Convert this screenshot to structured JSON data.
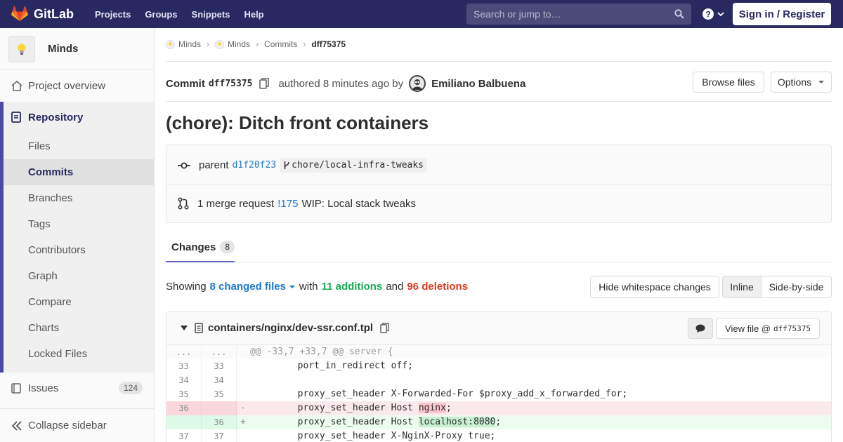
{
  "navbar": {
    "brand": "GitLab",
    "links": [
      "Projects",
      "Groups",
      "Snippets",
      "Help"
    ],
    "search_placeholder": "Search or jump to…",
    "signin_label": "Sign in / Register"
  },
  "sidebar": {
    "project_name": "Minds",
    "project_overview": "Project overview",
    "repository": "Repository",
    "repo_items": [
      "Files",
      "Commits",
      "Branches",
      "Tags",
      "Contributors",
      "Graph",
      "Compare",
      "Charts",
      "Locked Files"
    ],
    "issues": "Issues",
    "issues_count": "124",
    "collapse": "Collapse sidebar"
  },
  "breadcrumb": [
    "Minds",
    "Minds",
    "Commits",
    "dff75375"
  ],
  "commit": {
    "label": "Commit",
    "sha": "dff75375",
    "authored": "authored 8 minutes ago by",
    "author": "Emiliano Balbuena",
    "browse_files": "Browse files",
    "options": "Options",
    "title": "(chore): Ditch front containers",
    "parent_label": "parent",
    "parent_sha": "d1f20f23",
    "branch": "chore/local-infra-tweaks",
    "mr_text": "1 merge request",
    "mr_id": "!175",
    "mr_title": "WIP: Local stack tweaks"
  },
  "changes": {
    "tab_label": "Changes",
    "count": "8",
    "showing": "Showing",
    "files_changed": "8 changed files",
    "with": "with",
    "additions": "11 additions",
    "and": "and",
    "deletions": "96 deletions",
    "hide_whitespace": "Hide whitespace changes",
    "inline": "Inline",
    "side_by_side": "Side-by-side"
  },
  "file": {
    "path": "containers/nginx/dev-ssr.conf.tpl",
    "view_file_label": "View file @",
    "view_file_sha": "dff75375",
    "lines": [
      {
        "old": "...",
        "new": "...",
        "type": "hunk",
        "sign": "",
        "text": "@@ -33,7 +33,7 @@ server {"
      },
      {
        "old": "33",
        "new": "33",
        "type": "ctx",
        "sign": "",
        "text": "        port_in_redirect off;"
      },
      {
        "old": "34",
        "new": "34",
        "type": "ctx",
        "sign": "",
        "text": ""
      },
      {
        "old": "35",
        "new": "35",
        "type": "ctx",
        "sign": "",
        "text": "        proxy_set_header X-Forwarded-For $proxy_add_x_forwarded_for;"
      },
      {
        "old": "36",
        "new": "",
        "type": "del",
        "sign": "-",
        "text": "        proxy_set_header Host ",
        "hl": "nginx",
        "tail": ";"
      },
      {
        "old": "",
        "new": "36",
        "type": "add",
        "sign": "+",
        "text": "        proxy_set_header Host ",
        "hl": "localhost:8080",
        "tail": ";"
      },
      {
        "old": "37",
        "new": "37",
        "type": "ctx",
        "sign": "",
        "text": "        proxy_set_header X-NginX-Proxy true;"
      }
    ]
  }
}
